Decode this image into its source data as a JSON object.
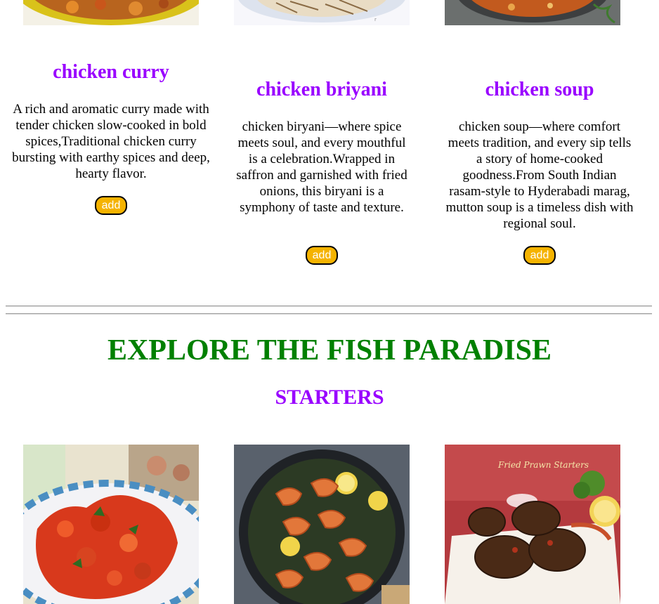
{
  "dishes": [
    {
      "title": "chicken curry",
      "description": "A rich and aromatic curry made with tender chicken slow-cooked in bold spices,Traditional chicken curry bursting with earthy spices and deep, hearty flavor.",
      "button_label": "add"
    },
    {
      "title": "chicken briyani",
      "description": "chicken biryani—where spice meets soul, and every mouthful is a celebration.Wrapped in saffron and garnished with fried onions, this biryani is a symphony of taste and texture.",
      "button_label": "add"
    },
    {
      "title": "chicken soup",
      "description": "chicken soup—where comfort meets tradition, and every sip tells a story of home-cooked goodness.From South Indian rasam-style to Hyderabadi marag, mutton soup is a timeless dish with regional soul.",
      "button_label": "add"
    }
  ],
  "section": {
    "heading": "EXPLORE THE FISH PARADISE",
    "subheading": "STARTERS"
  },
  "starter_images": [
    {
      "caption": ""
    },
    {
      "caption": ""
    },
    {
      "caption": "Fried Prawn Starters"
    }
  ],
  "colors": {
    "title": "#9900ff",
    "section_heading": "#008000",
    "button": "#f5b300"
  }
}
